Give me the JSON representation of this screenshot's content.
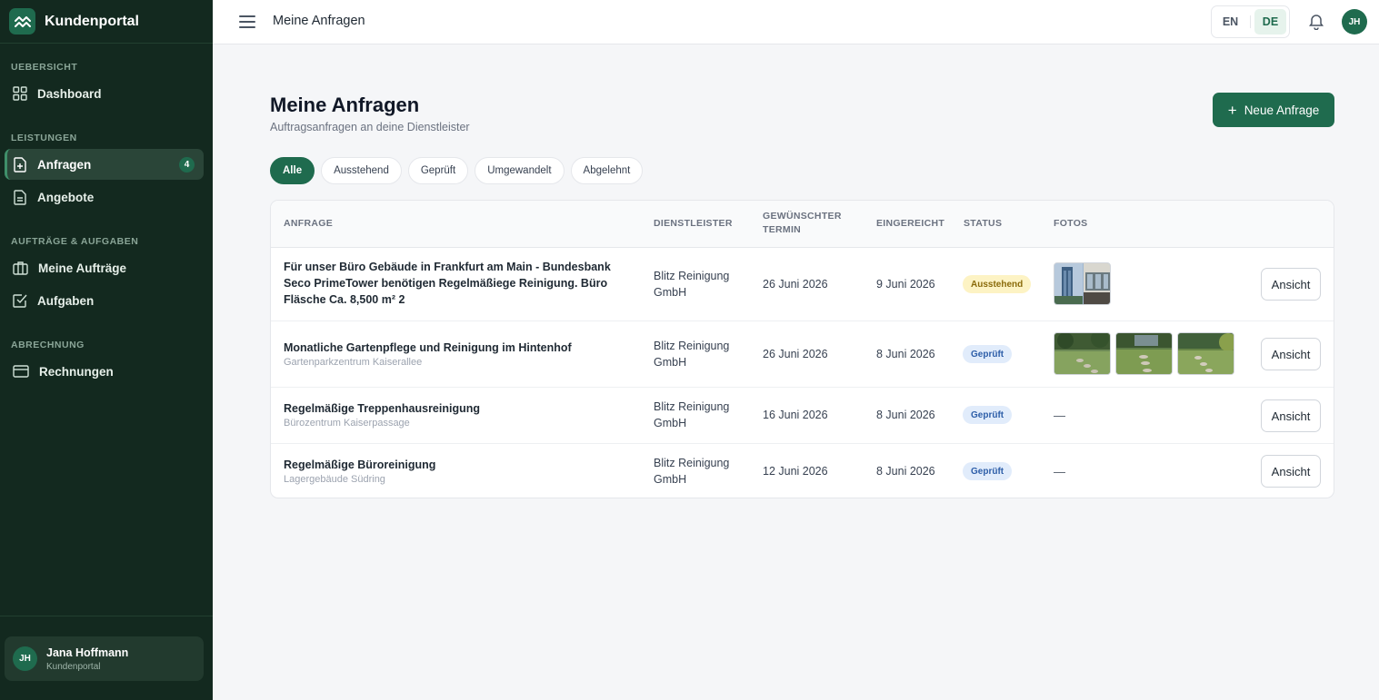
{
  "brand": {
    "name": "Kundenportal"
  },
  "sidebar": {
    "sections": [
      {
        "label": "UEBERSICHT"
      },
      {
        "label": "LEISTUNGEN"
      },
      {
        "label": "AUFTRÄGE & AUFGABEN"
      },
      {
        "label": "ABRECHNUNG"
      }
    ],
    "items": [
      {
        "label": "Dashboard",
        "icon": "grid-icon"
      },
      {
        "label": "Anfragen",
        "icon": "file-plus-icon",
        "badge": "4",
        "active": true
      },
      {
        "label": "Angebote",
        "icon": "file-text-icon"
      },
      {
        "label": "Meine Aufträge",
        "icon": "briefcase-icon"
      },
      {
        "label": "Aufgaben",
        "icon": "check-square-icon"
      },
      {
        "label": "Rechnungen",
        "icon": "credit-card-icon"
      }
    ],
    "user": {
      "initials": "JH",
      "name": "Jana Hoffmann",
      "role": "Kundenportal"
    }
  },
  "topbar": {
    "title": "Meine Anfragen",
    "languages": [
      "EN",
      "DE"
    ],
    "active_language": "DE",
    "avatar_initials": "JH"
  },
  "main": {
    "title": "Meine Anfragen",
    "subtitle": "Auftragsanfragen an deine Dienstleister",
    "new_button": "Neue Anfrage",
    "filters": [
      "Alle",
      "Ausstehend",
      "Geprüft",
      "Umgewandelt",
      "Abgelehnt"
    ],
    "active_filter": "Alle"
  },
  "table": {
    "headers": {
      "request": "ANFRAGE",
      "provider": "DIENSTLEISTER",
      "date_line1": "GEWÜNSCHTER",
      "date_line2": "TERMIN",
      "submitted": "EINGEREICHT",
      "status": "STATUS",
      "photos": "FOTOS"
    },
    "rows": [
      {
        "title": "Für unser Büro Gebäude in Frankfurt am Main - Bundesbank Seco PrimeTower benötigen Regelmäßiege Reinigung. Büro Fläsche Ca. 8,500 m² 2",
        "subtitle": "",
        "provider": "Blitz Reinigung GmbH",
        "requested_date": "26 Juni 2026",
        "submitted": "9 Juni 2026",
        "status": "Ausstehend",
        "photos": 1,
        "photos_text": "",
        "view_label": "Ansicht"
      },
      {
        "title": "Monatliche Gartenpflege und Reinigung im Hintenhof",
        "subtitle": "Gartenparkzentrum Kaiserallee",
        "provider": "Blitz Reinigung GmbH",
        "requested_date": "26 Juni 2026",
        "submitted": "8 Juni 2026",
        "status": "Geprüft",
        "photos": 3,
        "photos_text": "",
        "view_label": "Ansicht"
      },
      {
        "title": "Regelmäßige Treppenhausreinigung",
        "subtitle": "Bürozentrum Kaiserpassage",
        "provider": "Blitz Reinigung GmbH",
        "requested_date": "16 Juni 2026",
        "submitted": "8 Juni 2026",
        "status": "Geprüft",
        "photos": 0,
        "photos_text": "—",
        "view_label": "Ansicht"
      },
      {
        "title": "Regelmäßige Büroreinigung",
        "subtitle": "Lagergebäude Südring",
        "provider": "Blitz Reinigung GmbH",
        "requested_date": "12 Juni 2026",
        "submitted": "8 Juni 2026",
        "status": "Geprüft",
        "photos": 0,
        "photos_text": "—",
        "view_label": "Ansicht"
      }
    ]
  },
  "colors": {
    "sidebar_bg": "#13291f",
    "accent": "#1f6b4e",
    "status_pending_bg": "#fdf3c4",
    "status_checked_bg": "#e1ecfb"
  }
}
